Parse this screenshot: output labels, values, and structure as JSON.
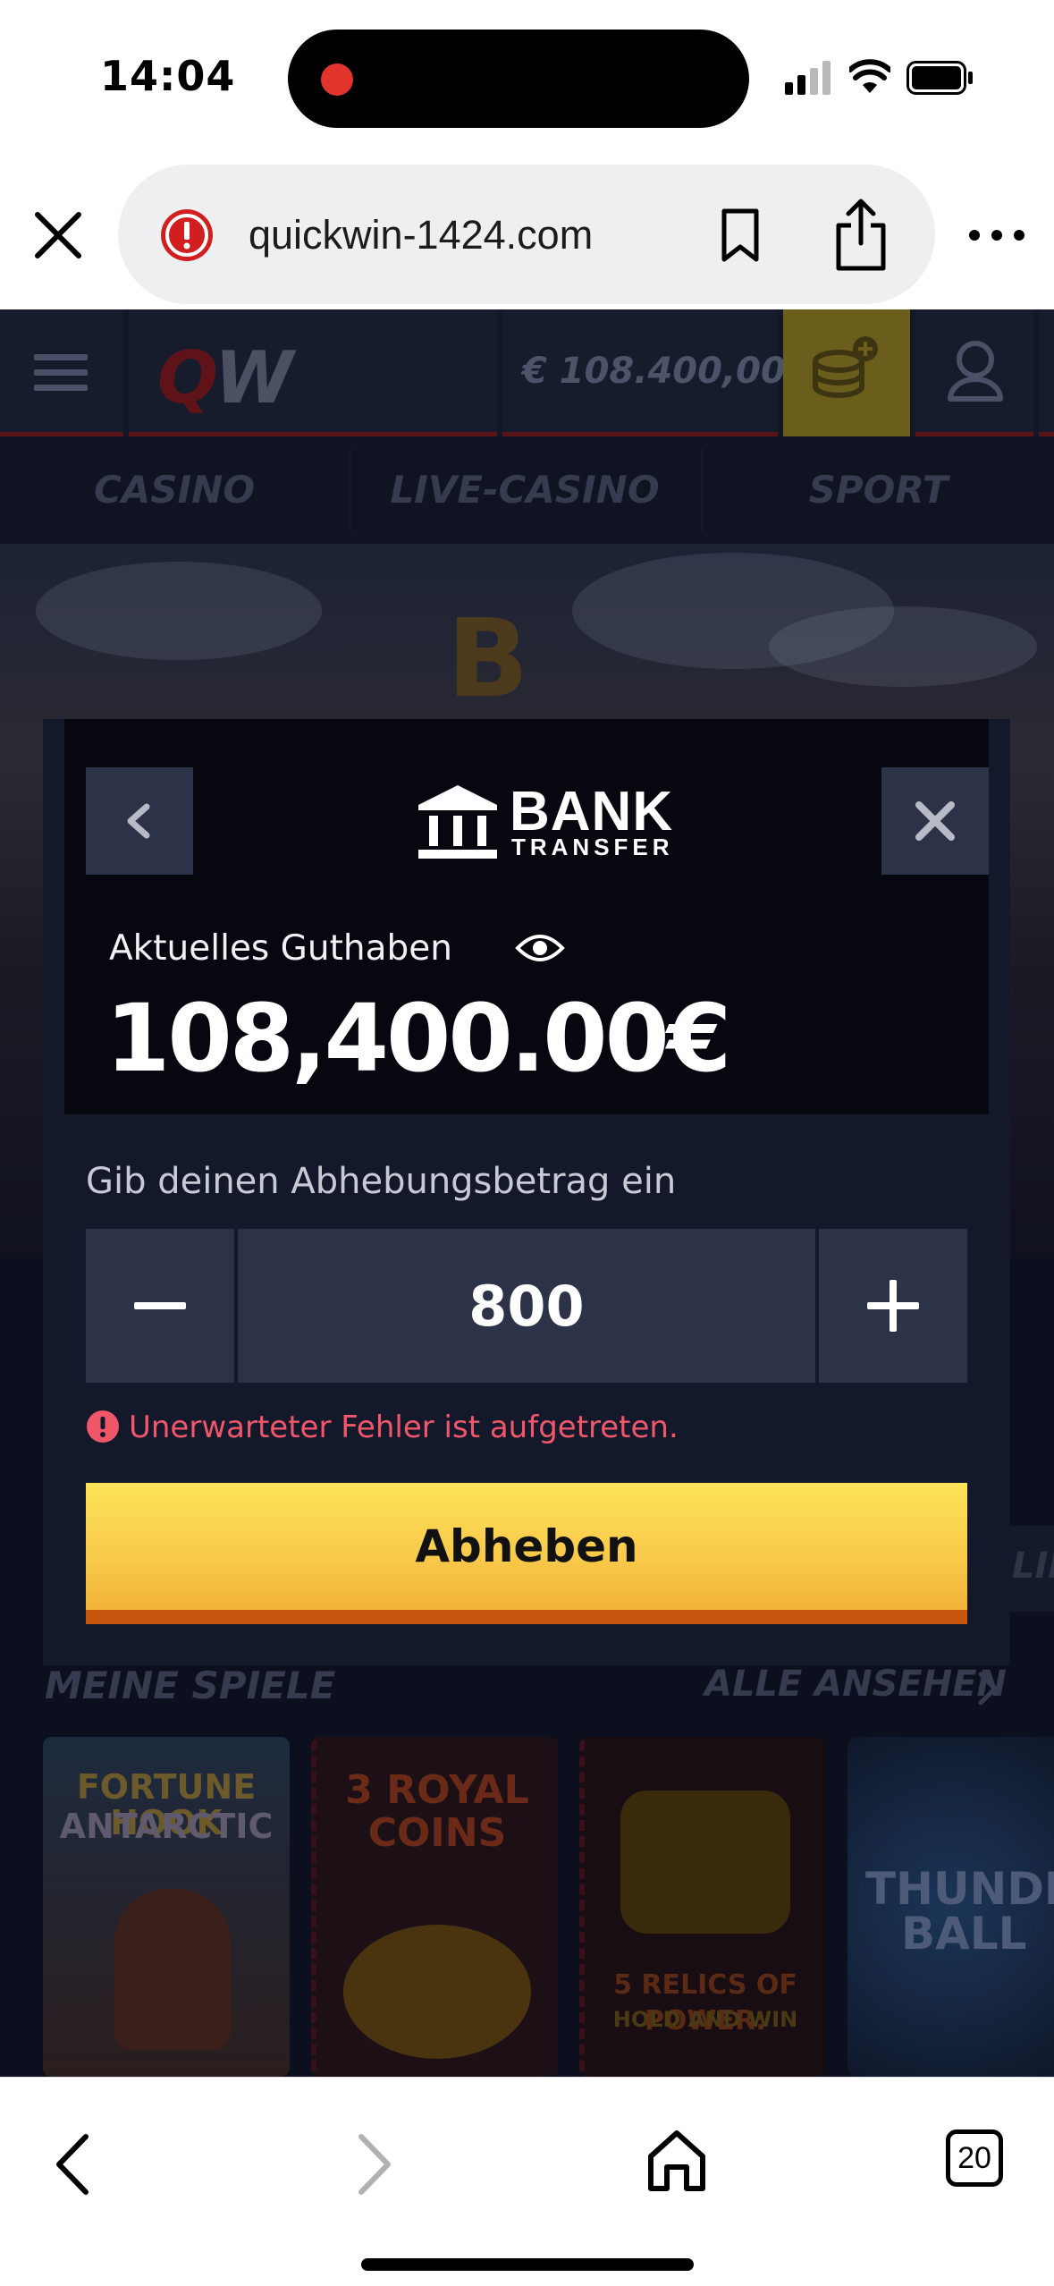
{
  "status_bar": {
    "time": "14:04",
    "recording_indicator": "record-dot-icon",
    "icons": [
      "cellular-signal-icon",
      "wifi-icon",
      "battery-icon"
    ]
  },
  "browser": {
    "url": "quickwin-1424.com",
    "security_icon": "warning-icon",
    "tab_count": "20"
  },
  "site": {
    "header": {
      "logo_q": "Q",
      "logo_w": "W",
      "balance": "€ 108.400,00"
    },
    "nav_tabs": [
      "CASINO",
      "LIVE-CASINO",
      "SPORT"
    ],
    "banner_coin": "B",
    "games": {
      "title": "MEINE SPIELE",
      "see_all": "ALLE ANSEHEN",
      "side_label": "LIE",
      "cards": [
        {
          "line1": "FORTUNE HOOK",
          "line2": "ANTARCTIC"
        },
        {
          "line1": "3 ROYAL",
          "line2": "COINS"
        },
        {
          "line1": "5 RELICS OF POWER:",
          "line2": "HOLD AND WIN"
        },
        {
          "line1": "THUNDER",
          "line2": "BALL"
        }
      ]
    }
  },
  "modal": {
    "logo_main": "BANK",
    "logo_sub": "TRANSFER",
    "balance_label": "Aktuelles Guthaben",
    "balance_value": "108,400.00€",
    "withdraw_label": "Gib deinen Abhebungsbetrag ein",
    "amount": "800",
    "error": "Unerwarteter Fehler ist aufgetreten.",
    "submit_label": "Abheben"
  },
  "colors": {
    "accent_yellow": "#f8c94a",
    "error_red": "#f0576a",
    "modal_bg": "#13182a",
    "button_bg": "#2c3247"
  }
}
